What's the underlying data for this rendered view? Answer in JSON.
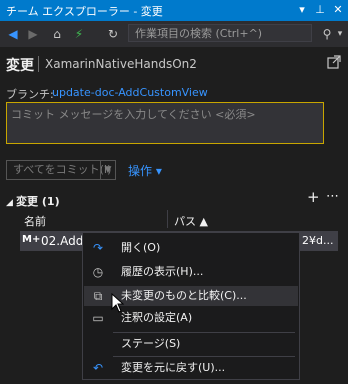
{
  "window": {
    "title": "チーム エクスプローラー - 変更",
    "buttons": [
      "dropdown-icon",
      "pin-icon",
      "close-icon"
    ]
  },
  "toolbar": {
    "search_placeholder": "作業項目の検索 (Ctrl+^)"
  },
  "page": {
    "title": "変更",
    "repo": "XamarinNativeHandsOn2",
    "branch_label": "ブランチ:",
    "branch_name": "update-doc-AddCustomView",
    "commit_message_placeholder": "コミット メッセージを入力してください <必須>",
    "commit_all_label": "すべてをコミット(I)",
    "actions_label": "操作 ▾"
  },
  "changes": {
    "section_title": "変更 (1)",
    "column_name": "名前",
    "column_path": "パス ▲",
    "rows": [
      {
        "badge": "M+",
        "name": "02.AddC",
        "path": "2¥d..."
      }
    ]
  },
  "context_menu": {
    "items": [
      {
        "label": "開く(O)",
        "icon": "open-arrow-icon"
      },
      {
        "label": "履歴の表示(H)...",
        "icon": "history-icon"
      },
      {
        "label": "未変更のものと比較(C)...",
        "icon": "compare-icon"
      },
      {
        "label": "注釈の設定(A)",
        "icon": "annotate-icon"
      },
      {
        "label": "ステージ(S)",
        "icon": ""
      },
      {
        "label": "変更を元に戻す(U)...",
        "icon": "undo-icon"
      }
    ]
  },
  "colors": {
    "accent": "#007acc",
    "link": "#3794ff",
    "background": "#1e1e1e",
    "message_border": "#c8a600"
  }
}
